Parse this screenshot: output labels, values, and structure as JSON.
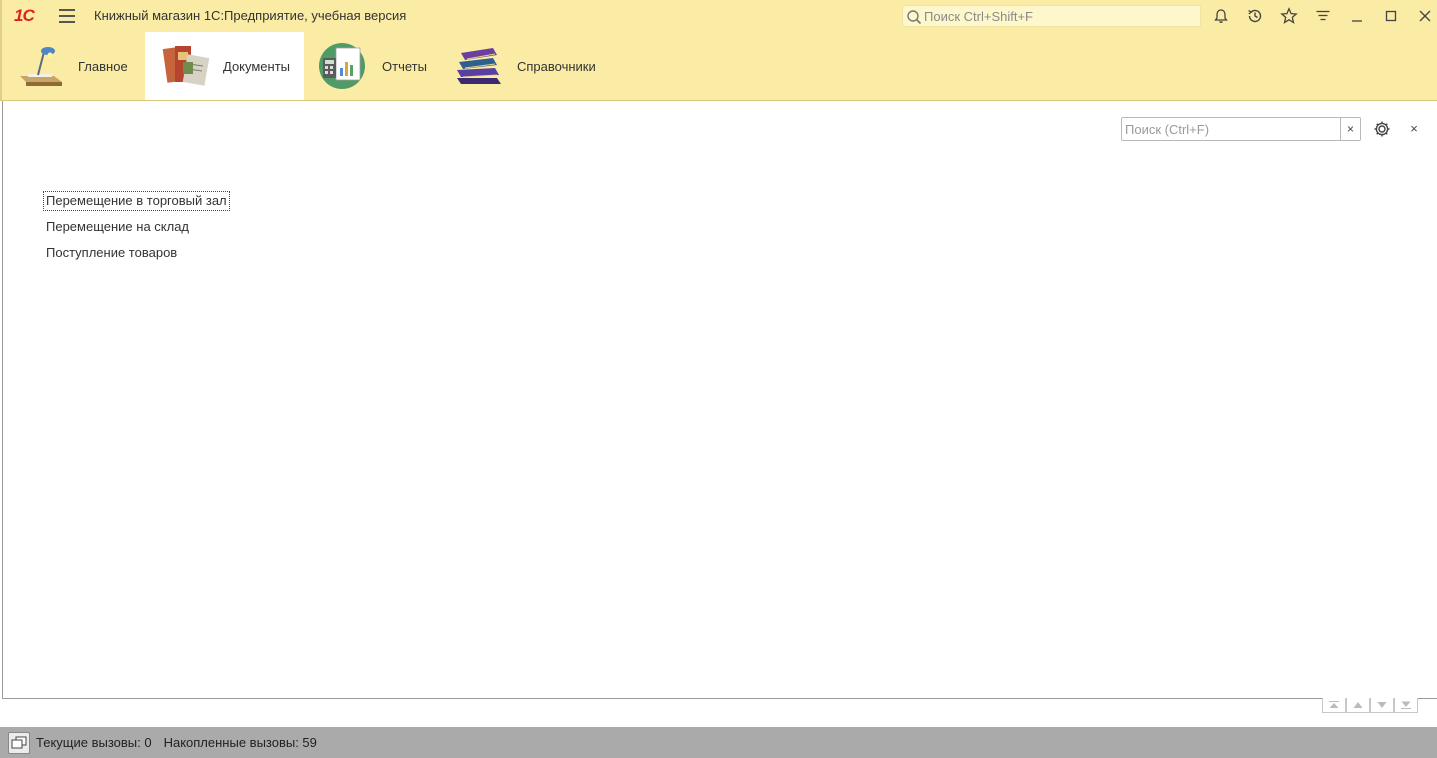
{
  "app": {
    "logo_text": "1С",
    "title": "Книжный магазин 1С:Предприятие, учебная версия"
  },
  "global_search": {
    "placeholder": "Поиск Ctrl+Shift+F"
  },
  "toolbar_icons": [
    "bell-icon",
    "history-icon",
    "star-icon",
    "filter-menu-icon",
    "minimize-icon",
    "maximize-icon",
    "close-icon"
  ],
  "sections": [
    {
      "label": "Главное",
      "icon": "desk-lamp-icon"
    },
    {
      "label": "Документы",
      "icon": "documents-icon",
      "active": true
    },
    {
      "label": "Отчеты",
      "icon": "reports-icon"
    },
    {
      "label": "Справочники",
      "icon": "books-icon"
    }
  ],
  "panel": {
    "search_placeholder": "Поиск (Ctrl+F)",
    "clear_label": "×",
    "close_label": "×",
    "items": [
      "Перемещение в торговый зал",
      "Перемещение на склад",
      "Поступление товаров"
    ]
  },
  "status": {
    "current_calls": "Текущие вызовы: 0",
    "accumulated_calls": "Накопленные вызовы: 59"
  },
  "colors": {
    "header_bg": "#fbeca5",
    "status_bg": "#aaaaaa",
    "active_section_bg": "#ffffff",
    "logo_red": "#dd2222"
  }
}
